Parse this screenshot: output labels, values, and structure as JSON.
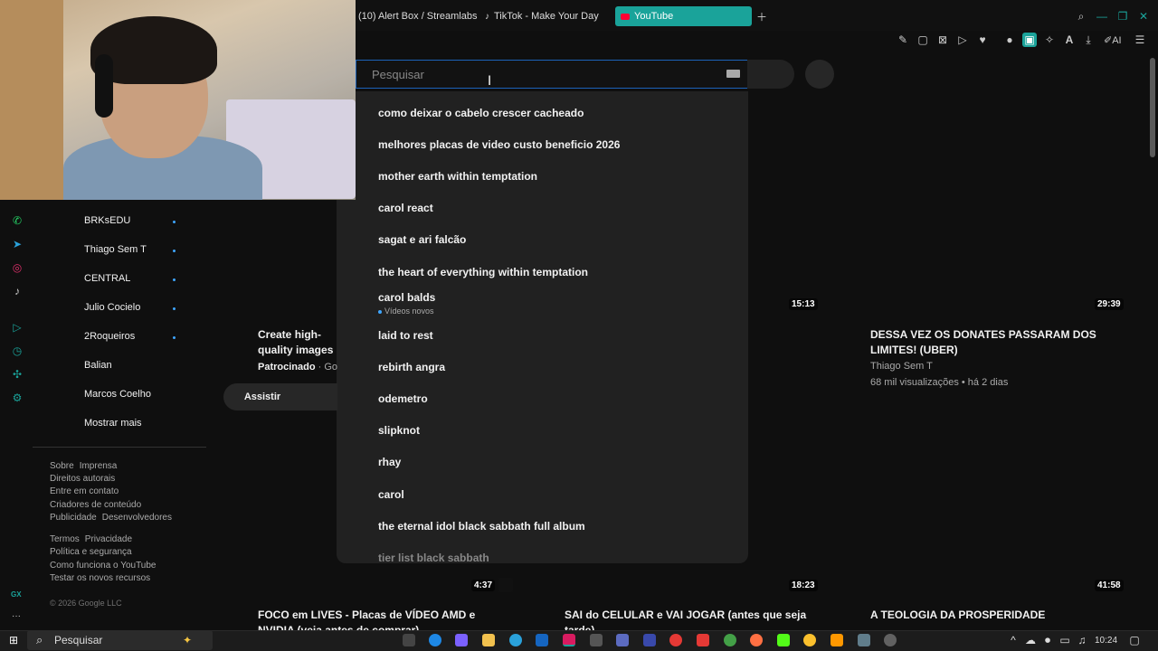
{
  "browser": {
    "tabs": [
      {
        "label": "(10) Alert Box / Streamlabs",
        "active": false
      },
      {
        "label": "TikTok - Make Your Day",
        "active": false
      },
      {
        "label": "YouTube",
        "active": true
      }
    ],
    "accent": "#1aa39a",
    "ai_label": "AI"
  },
  "search": {
    "placeholder": "Pesquisar",
    "suggestions": [
      "como deixar o cabelo crescer cacheado",
      "melhores placas de video custo beneficio 2026",
      "mother earth within temptation",
      "carol react",
      "sagat e ari falcão",
      "the heart of everything within temptation",
      "carol balds",
      "laid to rest",
      "rebirth angra",
      "odemetro",
      "slipknot",
      "rhay",
      "carol",
      "the eternal idol black sabbath full album",
      "tier list black sabbath"
    ],
    "suggestion_sub": "Vídeos novos"
  },
  "subscriptions": [
    {
      "name": "BRKsEDU",
      "new": true
    },
    {
      "name": "Thiago Sem T",
      "new": true
    },
    {
      "name": "CENTRAL",
      "new": true
    },
    {
      "name": "Julio Cocielo",
      "new": true
    },
    {
      "name": "2Roqueiros",
      "new": true
    },
    {
      "name": "Balian",
      "new": false
    },
    {
      "name": "Marcos Coelho",
      "new": false
    },
    {
      "name": "Mostrar mais",
      "new": false
    }
  ],
  "footer": {
    "row1": [
      "Sobre",
      "Imprensa"
    ],
    "row2": [
      "Direitos autorais"
    ],
    "row3": [
      "Entre em contato"
    ],
    "row4": [
      "Criadores de conteúdo"
    ],
    "row5": [
      "Publicidade",
      "Desenvolvedores"
    ],
    "row6": [
      "Termos",
      "Privacidade"
    ],
    "row7": [
      "Política e segurança"
    ],
    "row8": [
      "Como funciona o YouTube"
    ],
    "row9": [
      "Testar os novos recursos"
    ],
    "copyright": "© 2026 Google LLC"
  },
  "feed": {
    "ad": {
      "title": "Create high-quality images with Gemini in Plus.",
      "sponsored": "Patrocinado",
      "advertiser": "Google",
      "watch": "Assistir"
    },
    "durations_top": [
      "15:13",
      "29:39"
    ],
    "video_right": {
      "title": "DESSA VEZ OS DONATES PASSARAM DOS LIMITES! (UBER)",
      "channel": "Thiago Sem T",
      "meta": "68 mil visualizações • há 2 dias"
    },
    "durations_bottom": [
      "4:37",
      "18:23",
      "41:58"
    ],
    "bottom_titles": [
      "FOCO em LIVES - Placas de VÍDEO AMD e NVIDIA (veja antes de comprar)",
      "SAI do CELULAR e VAI JOGAR (antes que seja tarde)",
      "A TEOLOGIA DA PROSPERIDADE"
    ]
  },
  "rail": {
    "label": "GX"
  },
  "taskbar": {
    "search": "Pesquisar",
    "time": "10:24"
  }
}
